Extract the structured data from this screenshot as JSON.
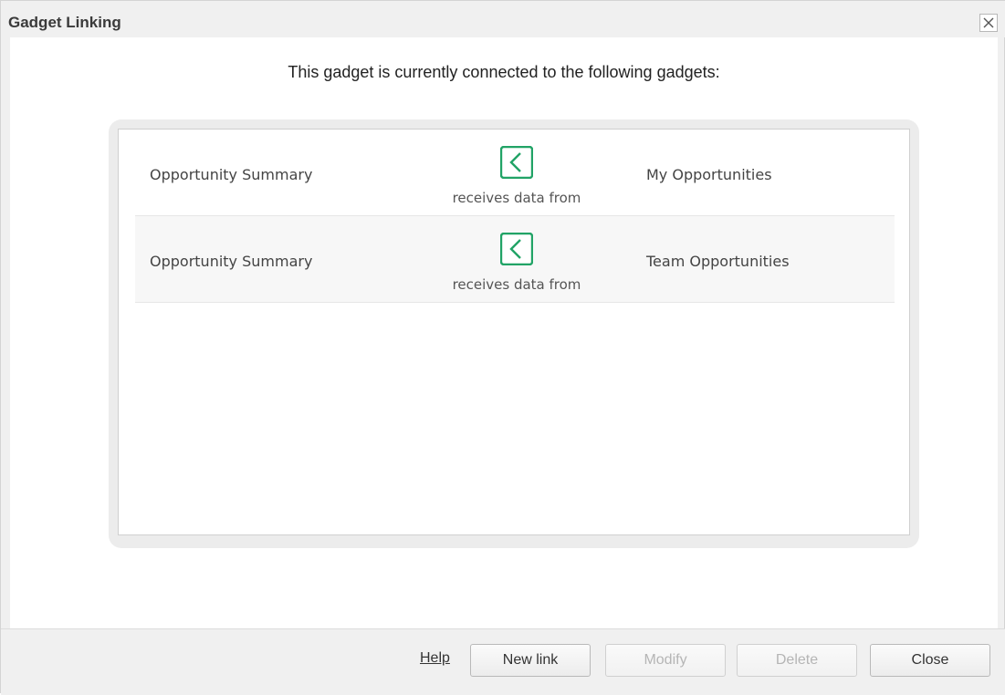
{
  "dialog": {
    "title": "Gadget Linking",
    "close_icon": "close-icon"
  },
  "main": {
    "heading": "This gadget is currently connected to the following gadgets:"
  },
  "links": [
    {
      "source": "Opportunity Summary",
      "relation": "receives data from",
      "target": "My Opportunities",
      "icon": "chevron-left-icon"
    },
    {
      "source": "Opportunity Summary",
      "relation": "receives data from",
      "target": "Team Opportunities",
      "icon": "chevron-left-icon"
    }
  ],
  "footer": {
    "help_label": "Help",
    "new_link_label": "New link",
    "modify_label": "Modify",
    "delete_label": "Delete",
    "close_label": "Close"
  },
  "colors": {
    "accent": "#21a366",
    "disabled_text": "#b5b5b5"
  }
}
